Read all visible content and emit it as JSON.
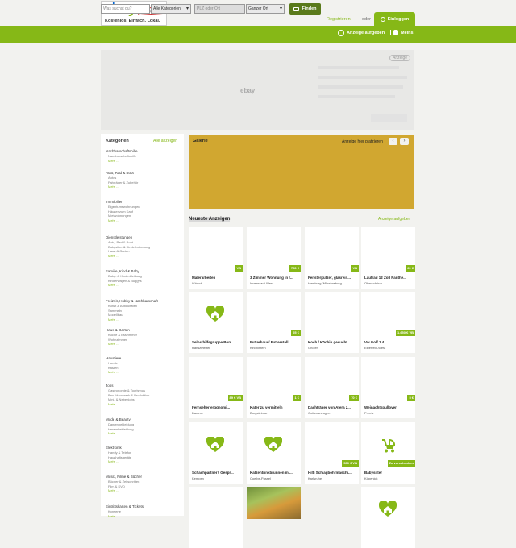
{
  "header": {
    "logo_badge": "Kleinanzeigen",
    "tagline": "Kostenlos. Einfach. Lokal.",
    "register_label": "Registrieren",
    "or_label": "oder",
    "login_label": "Einloggen"
  },
  "searchbar": {
    "query_placeholder": "Was suchst du?",
    "category_value": "Alle Kategorien",
    "location_placeholder": "PLZ oder Ort",
    "radius_value": "Ganzer Ort",
    "find_label": "Finden",
    "post_ad_label": "Anzeige aufgeben",
    "mine_label": "Meins"
  },
  "ad": {
    "logo_text": "ebay",
    "label": "Anzeige"
  },
  "sidebar": {
    "heading": "Kategorien",
    "all_label": "Alle anzeigen",
    "more_label": "Mehr ...",
    "categories": [
      {
        "title": "Nachbarschaftshilfe",
        "subs": [
          "Nachbarschaftshilfe"
        ]
      },
      {
        "title": "Auto, Rad & Boot",
        "subs": [
          "Autos",
          "Fahrräder & Zubehör"
        ]
      },
      {
        "title": "Immobilien",
        "subs": [
          "Eigentumswohnungen",
          "Häuser zum Kauf",
          "Mietwohnungen"
        ]
      },
      {
        "title": "Dienstleistungen",
        "subs": [
          "Auto, Rad & Boot",
          "Babysitter & Kinderbetreuung",
          "Haus & Garten"
        ]
      },
      {
        "title": "Familie, Kind & Baby",
        "subs": [
          "Baby- & Kinderkleidung",
          "Kinderwagen & Buggys"
        ]
      },
      {
        "title": "Freizeit, Hobby & Nachbarschaft",
        "subs": [
          "Kunst & Antiquitäten",
          "Sammeln",
          "Modellbau"
        ]
      },
      {
        "title": "Haus & Garten",
        "subs": [
          "Küche & Esszimmer",
          "Wohnzimmer"
        ]
      },
      {
        "title": "Haustiere",
        "subs": [
          "Hunde",
          "Katzen"
        ]
      },
      {
        "title": "Jobs",
        "subs": [
          "Gastronomie & Tourismus",
          "Bau, Handwerk & Produktion",
          "Mini- & Nebenjobs"
        ]
      },
      {
        "title": "Mode & Beauty",
        "subs": [
          "Damenbekleidung",
          "Herrenbekleidung"
        ]
      },
      {
        "title": "Elektronik",
        "subs": [
          "Handy & Telefon",
          "Haushaltsgeräte"
        ]
      },
      {
        "title": "Musik, Filme & Bücher",
        "subs": [
          "Bücher & Zeitschriften",
          "Film & DVD"
        ]
      },
      {
        "title": "Eintrittskarten & Tickets",
        "subs": [
          "Konzerte"
        ]
      }
    ]
  },
  "gallery": {
    "title": "Galerie",
    "cta": "Anzeige hier platzieren"
  },
  "newest": {
    "title": "Neueste Anzeigen",
    "post_link": "Anzeige aufgeben"
  },
  "listings": [
    {
      "title": "Malerarbeiten",
      "place": "Lübeck",
      "price": "VB",
      "image": "blank"
    },
    {
      "title": "3 Zimmer Wohnung in r...",
      "place": "Innenstadt-West",
      "price": "750 €",
      "image": "blank"
    },
    {
      "title": "Fensterputzer, glasrein...",
      "place": "Hamburg Wilhelmsburg",
      "price": "VB",
      "image": "blank"
    },
    {
      "title": "Laufrad 12 Zoll Panthe...",
      "place": "Oberschöna",
      "price": "20 €",
      "image": "blank"
    },
    {
      "title": "Selbsthilfegruppe Borr...",
      "place": "Hansaviertel",
      "price": "",
      "image": "placeholder"
    },
    {
      "title": "Futterhaus/ Futterstell...",
      "place": "Kirchlinteln",
      "price": "25 €",
      "image": "blank"
    },
    {
      "title": "Koch / Köchin gesucht...",
      "place": "Gnoien",
      "price": "",
      "image": "blank"
    },
    {
      "title": "Vw Golf 1.4",
      "place": "Elberfeld-West",
      "price": "1.650 € VB",
      "image": "blank"
    },
    {
      "title": "Fernseher ergonomi...",
      "place": "Damme",
      "price": "89 € VB",
      "image": "blank"
    },
    {
      "title": "Kater zu vermitteln",
      "place": "Burgsteinfurt",
      "price": "1 €",
      "image": "blank"
    },
    {
      "title": "Dachträger von Atera z...",
      "place": "Gothmannsgen",
      "price": "70 €",
      "image": "blank"
    },
    {
      "title": "Weinachtspullover",
      "place": "Preetz",
      "price": "5 €",
      "image": "blank"
    },
    {
      "title": "Schachpartner / Gespr...",
      "place": "Kempen",
      "price": "",
      "image": "placeholder"
    },
    {
      "title": "Katzentrinkbrunnen mi...",
      "place": "Coelbe-Passel",
      "price": "",
      "image": "placeholder"
    },
    {
      "title": "Hilti Schlagbohrmaschi...",
      "place": "Karlsruhe",
      "price": "500 € VB",
      "image": "blank"
    },
    {
      "title": "Babysitter",
      "place": "Köpenick",
      "price": "Zu verschenken",
      "image": "stroller"
    },
    {
      "title": "",
      "place": "",
      "price": "",
      "image": "blank"
    },
    {
      "title": "",
      "place": "",
      "price": "",
      "image": "photo"
    },
    {
      "title": "",
      "place": "",
      "price": "",
      "image": "none"
    },
    {
      "title": "",
      "place": "",
      "price": "",
      "image": "placeholder"
    }
  ],
  "colors": {
    "brand": "#86b817",
    "gallery": "#d1a730",
    "background": "#f2f2ef"
  }
}
